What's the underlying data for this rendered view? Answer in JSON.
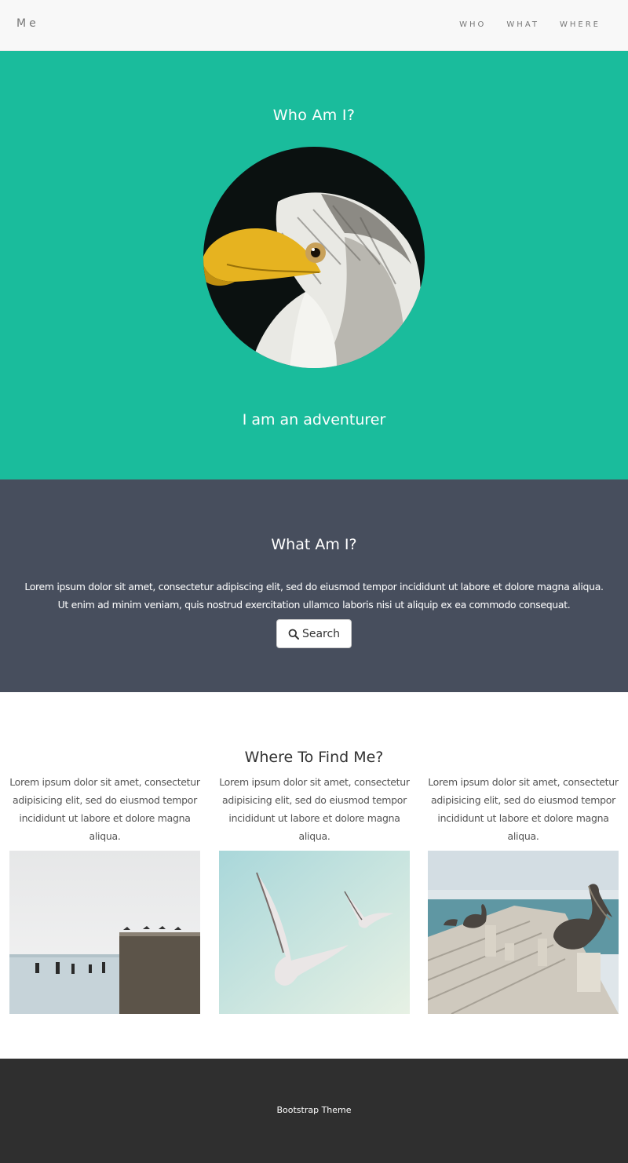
{
  "navbar": {
    "brand": "Me",
    "links": [
      "WHO",
      "WHAT",
      "WHERE"
    ]
  },
  "who": {
    "title": "Who Am I?",
    "subtitle": "I am an adventurer"
  },
  "what": {
    "title": "What Am I?",
    "paragraph_line1": "Lorem ipsum dolor sit amet, consectetur adipiscing elit, sed do eiusmod tempor incididunt ut labore et dolore magna aliqua.",
    "paragraph_line2": "Ut enim ad minim veniam, quis nostrud exercitation ullamco laboris nisi ut aliquip ex ea commodo consequat.",
    "search_label": "Search"
  },
  "where": {
    "title": "Where To Find Me?",
    "columns": [
      {
        "text": "Lorem ipsum dolor sit amet, consectetur adipisicing elit, sed do eiusmod tempor incididunt ut labore et dolore magna aliqua."
      },
      {
        "text": "Lorem ipsum dolor sit amet, consectetur adipisicing elit, sed do eiusmod tempor incididunt ut labore et dolore magna aliqua."
      },
      {
        "text": "Lorem ipsum dolor sit amet, consectetur adipisicing elit, sed do eiusmod tempor incididunt ut labore et dolore magna aliqua."
      }
    ]
  },
  "footer": {
    "text": "Bootstrap Theme"
  },
  "colors": {
    "who_bg": "#1abc9c",
    "what_bg": "#474e5d",
    "footer_bg": "#2f2f2f"
  }
}
